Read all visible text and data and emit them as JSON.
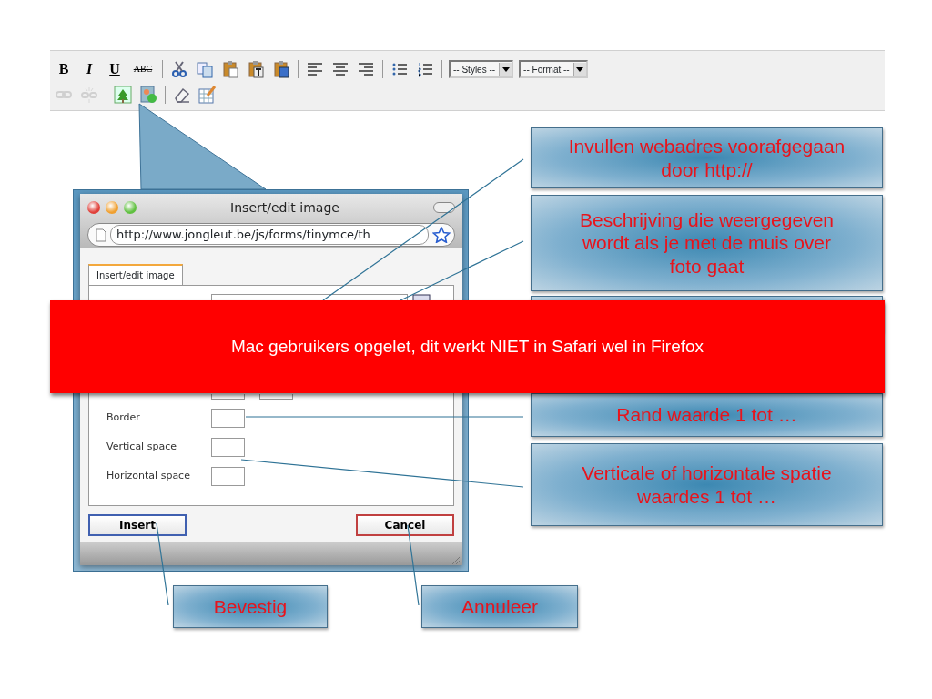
{
  "toolbar": {
    "rows": [
      [
        {
          "kind": "text",
          "label": "B"
        },
        {
          "kind": "text",
          "label": "I"
        },
        {
          "kind": "text",
          "label": "U"
        },
        {
          "kind": "text",
          "label": "ABC"
        },
        {
          "kind": "separator"
        },
        {
          "kind": "cut"
        },
        {
          "kind": "copy"
        },
        {
          "kind": "paste"
        },
        {
          "kind": "paste-text"
        },
        {
          "kind": "paste-word"
        },
        {
          "kind": "separator"
        },
        {
          "kind": "align-left"
        },
        {
          "kind": "align-center"
        },
        {
          "kind": "align-right"
        },
        {
          "kind": "separator"
        },
        {
          "kind": "bullet-list"
        },
        {
          "kind": "number-list"
        },
        {
          "kind": "separator"
        },
        {
          "kind": "dropdown",
          "label": "-- Styles --"
        },
        {
          "kind": "dropdown",
          "label": "-- Format --"
        }
      ],
      [
        {
          "kind": "link",
          "disabled": true
        },
        {
          "kind": "unlink",
          "disabled": true
        },
        {
          "kind": "separator"
        },
        {
          "kind": "image",
          "disabled": false
        },
        {
          "kind": "media",
          "disabled": false
        },
        {
          "kind": "separator"
        },
        {
          "kind": "eraser"
        },
        {
          "kind": "table-edit"
        }
      ]
    ]
  },
  "dialog": {
    "title": "Insert/edit image",
    "url": "http://www.jongleut.be/js/forms/tinymce/th",
    "tabs": [
      {
        "label": "Insert/edit image",
        "selected": true
      }
    ],
    "fields": [
      {
        "label": "Border"
      },
      {
        "label": "Vertical space"
      },
      {
        "label": "Horizontal space"
      }
    ],
    "buttons": [
      {
        "label": "Insert",
        "kind": "confirm"
      },
      {
        "label": "Cancel",
        "kind": "cancel"
      }
    ]
  },
  "callouts": [
    {
      "text": "Invullen webadres voorafgegaan door http://"
    },
    {
      "text": "Beschrijving die weergegeven wordt als je met de muis over foto gaat"
    },
    {
      "text": "Rand waarde 1 tot …"
    },
    {
      "text": "Verticale of horizontale spatie waardes 1 tot …"
    },
    {
      "text": "Bevestig"
    },
    {
      "text": "Annuleer"
    }
  ],
  "banner": {
    "text": "Mac gebruikers opgelet, dit werkt NIET in Safari wel in Firefox"
  }
}
